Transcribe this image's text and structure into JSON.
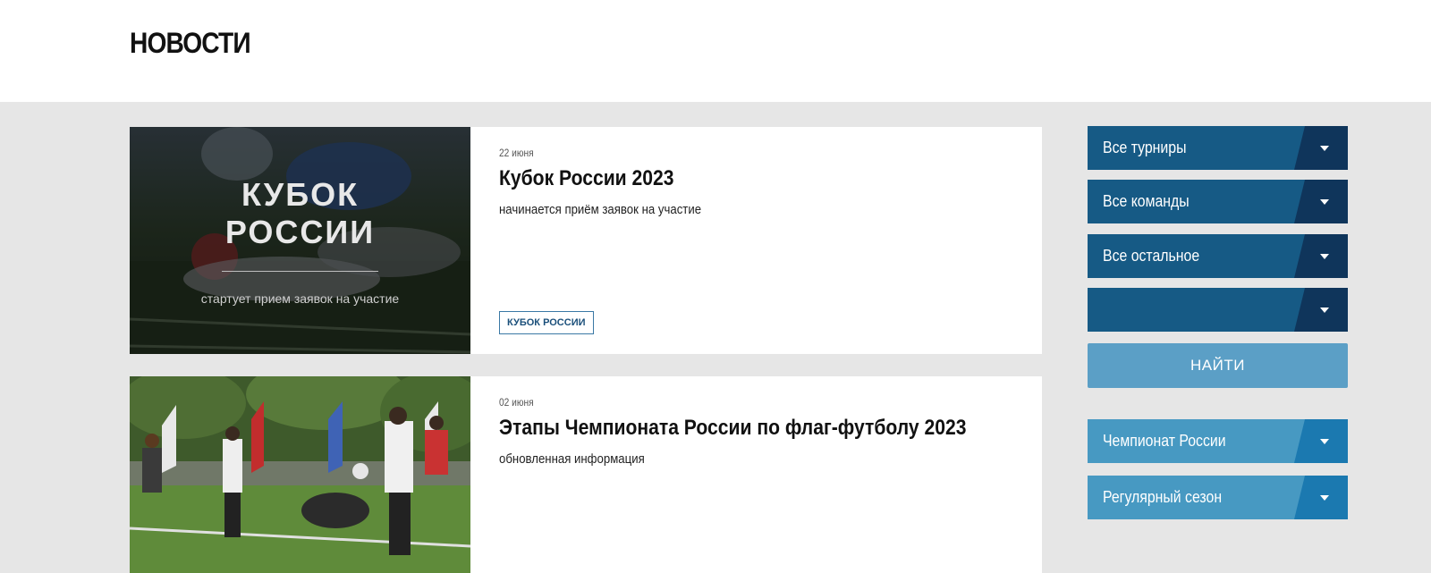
{
  "page": {
    "title": "НОВОСТИ"
  },
  "news": [
    {
      "date": "22 июня",
      "title": "Кубок России 2023",
      "subtitle": "начинается приём заявок на участие",
      "tag": "КУБОК РОССИИ",
      "image_text": {
        "line1": "КУБОК",
        "line2": "РОССИИ",
        "caption": "стартует прием заявок на участие"
      }
    },
    {
      "date": "02 июня",
      "title": "Этапы Чемпионата России по флаг-футболу 2023",
      "subtitle": "обновленная информация"
    }
  ],
  "filters": {
    "tournaments": "Все турниры",
    "teams": "Все команды",
    "other": "Все остальное",
    "extra": "",
    "find_label": "НАЙТИ"
  },
  "categories": [
    {
      "label": "Чемпионат России"
    },
    {
      "label": "Регулярный сезон"
    }
  ],
  "colors": {
    "filter_dark": "#165a85",
    "filter_dark_arrow": "#0f355b",
    "filter_light": "#4799c2",
    "filter_light_arrow": "#1b79b0",
    "find_button": "#5b9fc6",
    "background": "#e6e6e6"
  },
  "icons": {
    "dropdown": "chevron-down-icon"
  }
}
